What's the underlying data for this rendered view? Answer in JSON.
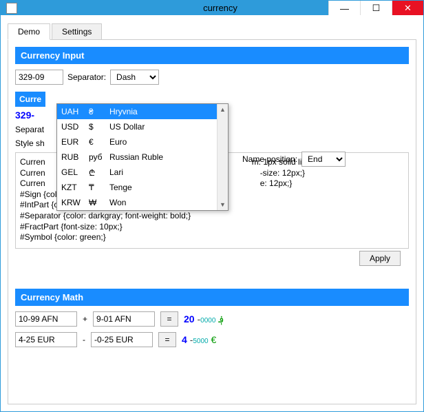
{
  "window": {
    "title": "currency"
  },
  "tabs": {
    "demo": "Demo",
    "settings": "Settings"
  },
  "input_section": {
    "title": "Currency Input",
    "value": "329-09",
    "separator_label": "Separator:",
    "separator_value": "Dash"
  },
  "dropdown": {
    "selected": "UAH",
    "items": [
      {
        "code": "UAH",
        "sign": "₴",
        "name": "Hryvnia"
      },
      {
        "code": "USD",
        "sign": "$",
        "name": "US Dollar"
      },
      {
        "code": "EUR",
        "sign": "€",
        "name": "Euro"
      },
      {
        "code": "RUB",
        "sign": "руб",
        "name": "Russian Ruble"
      },
      {
        "code": "GEL",
        "sign": "₾",
        "name": "Lari"
      },
      {
        "code": "KZT",
        "sign": "₸",
        "name": "Tenge"
      },
      {
        "code": "KRW",
        "sign": "₩",
        "name": "Won"
      }
    ]
  },
  "preview": {
    "title_fragment": "Curre",
    "value_fragment": "329-",
    "separator_label_fragment": "Separat",
    "style_label_fragment": "Style sh",
    "namepos_label": "Name position:",
    "namepos_value": "End"
  },
  "stylesheet": {
    "visible_tail_1": "m: 1px solid lightgray;}",
    "visible_tail_2": "-size: 12px;}",
    "visible_tail_3": "e: 12px;}",
    "line1_head": "Curren",
    "line2_head": "Curren",
    "line3_head": "Curren",
    "lines": [
      "#Sign {color: magenta; font-weight: bold;}",
      "#IntPart {color: blue; font-size: 14px; font-weight: bold;}",
      "#Separator {color: darkgray; font-weight: bold;}",
      "#FractPart {font-size: 10px;}",
      "#Symbol {color: green;}"
    ],
    "apply": "Apply"
  },
  "math": {
    "title": "Currency Math",
    "rows": [
      {
        "a": "10-99 AFN",
        "op": "+",
        "b": "9-01 AFN",
        "eq": "=",
        "int": "20",
        "sep": "-",
        "fract": "0000",
        "sym": "؋"
      },
      {
        "a": "4-25 EUR",
        "op": "-",
        "b": "-0-25 EUR",
        "eq": "=",
        "int": "4",
        "sep": "-",
        "fract": "5000",
        "sym": "€"
      }
    ]
  }
}
